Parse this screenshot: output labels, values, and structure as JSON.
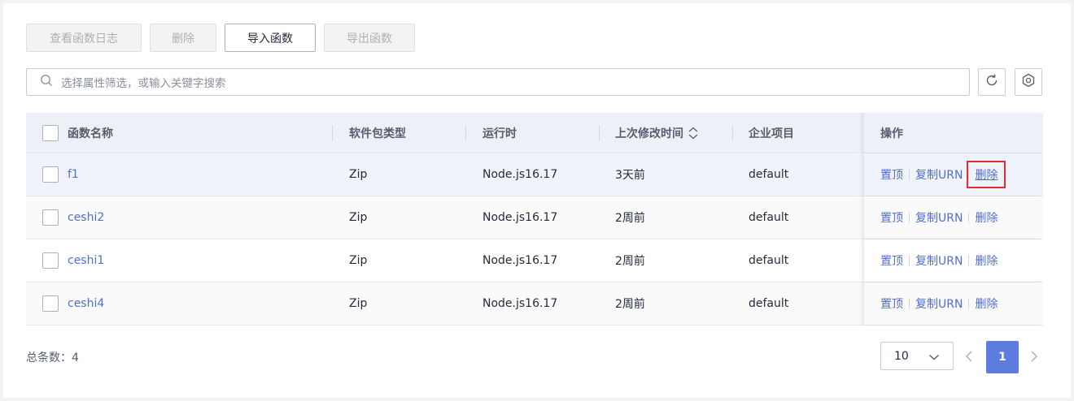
{
  "toolbar": {
    "view_logs": "查看函数日志",
    "delete": "删除",
    "import": "导入函数",
    "export": "导出函数"
  },
  "search": {
    "placeholder": "选择属性筛选，或输入关键字搜索"
  },
  "table": {
    "headers": {
      "name": "函数名称",
      "package_type": "软件包类型",
      "runtime": "运行时",
      "last_modified": "上次修改时间",
      "project": "企业项目",
      "ops": "操作"
    },
    "rows": [
      {
        "name": "f1",
        "package_type": "Zip",
        "runtime": "Node.js16.17",
        "last_modified": "3天前",
        "project": "default"
      },
      {
        "name": "ceshi2",
        "package_type": "Zip",
        "runtime": "Node.js16.17",
        "last_modified": "2周前",
        "project": "default"
      },
      {
        "name": "ceshi1",
        "package_type": "Zip",
        "runtime": "Node.js16.17",
        "last_modified": "2周前",
        "project": "default"
      },
      {
        "name": "ceshi4",
        "package_type": "Zip",
        "runtime": "Node.js16.17",
        "last_modified": "2周前",
        "project": "default"
      }
    ],
    "ops": {
      "pin": "置顶",
      "copy_urn": "复制URN",
      "delete": "删除"
    }
  },
  "footer": {
    "total_label": "总条数：4",
    "page_size": "10",
    "current_page": "1"
  },
  "colors": {
    "link": "#526ecc",
    "primary": "#5e7ce0",
    "highlight_box": "#e52c2c"
  }
}
